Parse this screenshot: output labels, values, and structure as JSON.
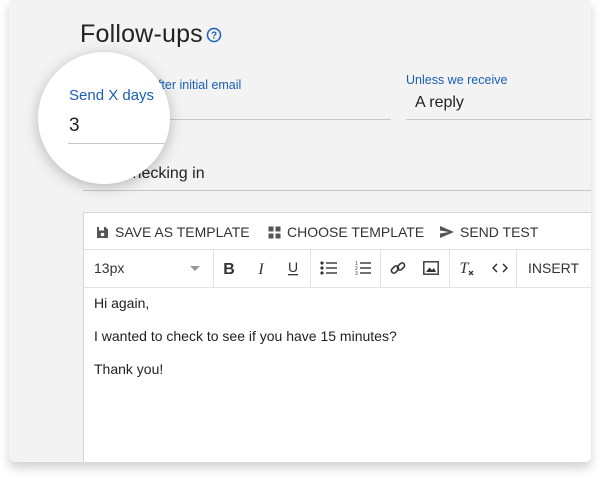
{
  "page": {
    "title": "Follow-ups"
  },
  "fields": {
    "send_after_suffix": "after initial email",
    "unless_label": "Unless we receive",
    "unless_value": "A reply",
    "subject_value": "Checking in"
  },
  "magnifier": {
    "label": "Send X days",
    "value": "3"
  },
  "toolbar": {
    "save_template": "SAVE AS TEMPLATE",
    "choose_template": "CHOOSE TEMPLATE",
    "send_test": "SEND TEST"
  },
  "format_bar": {
    "font_size": "13px",
    "insert": "INSERT",
    "icons": [
      "bold-icon",
      "italic-icon",
      "underline-icon",
      "bulleted-list-icon",
      "numbered-list-icon",
      "link-icon",
      "image-icon",
      "clear-format-icon",
      "code-icon"
    ]
  },
  "email_body": {
    "lines": [
      "Hi again,",
      "I wanted to check to see if you have 15 minutes?",
      "Thank you!"
    ]
  },
  "colors": {
    "accent": "#1a5fb4",
    "background": "#f3f3f3"
  }
}
